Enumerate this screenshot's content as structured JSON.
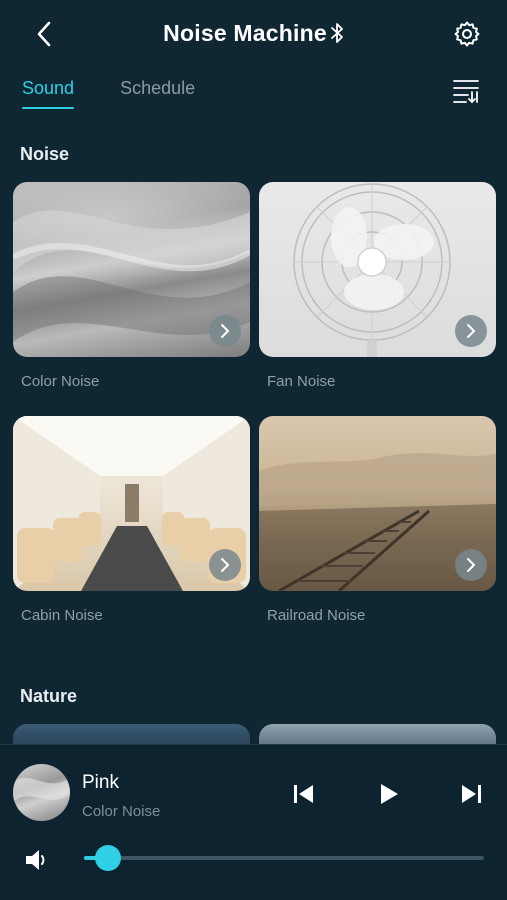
{
  "header": {
    "title": "Noise Machine"
  },
  "tabs": [
    {
      "label": "Sound",
      "active": true
    },
    {
      "label": "Schedule",
      "active": false
    }
  ],
  "sections": {
    "noise": {
      "title": "Noise",
      "cards": [
        {
          "label": "Color Noise"
        },
        {
          "label": "Fan Noise"
        },
        {
          "label": "Cabin Noise"
        },
        {
          "label": "Railroad Noise"
        }
      ]
    },
    "nature": {
      "title": "Nature"
    }
  },
  "player": {
    "track_name": "Pink",
    "track_category": "Color Noise",
    "volume": 0.06
  },
  "colors": {
    "accent": "#2fd0e6",
    "background": "#0f2633"
  },
  "icons": {
    "back": "chevron-left-icon",
    "bluetooth": "bluetooth-icon",
    "settings": "gear-icon",
    "sort": "sort-list-icon",
    "card_arrow": "chevron-right-icon",
    "prev": "skip-previous-icon",
    "play": "play-icon",
    "next": "skip-next-icon",
    "volume": "speaker-icon"
  }
}
